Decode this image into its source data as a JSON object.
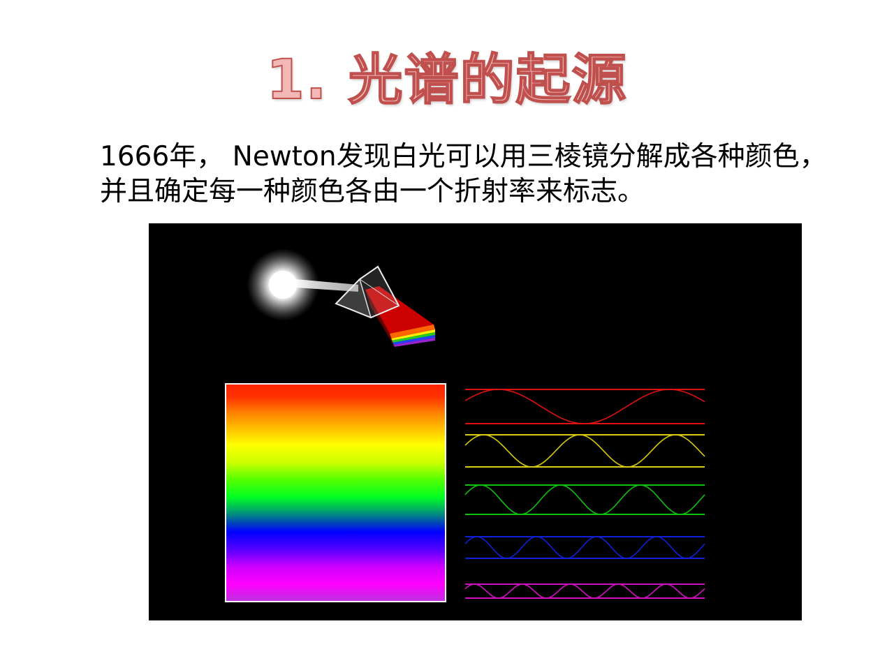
{
  "slide": {
    "title": "1. 光谱的起源",
    "paragraph": "1666年，  Newton发现白光可以用三棱镜分解成各种颜色，并且确定每一种颜色各由一个折射率来标志。"
  },
  "illustration": {
    "background_color": "#000000",
    "light_source_icon": "light-source-icon",
    "prism_icon": "prism-icon",
    "spectrum_colors": [
      "#ff0000",
      "#ff8800",
      "#ffff00",
      "#00ff00",
      "#0000ff",
      "#ff00ff",
      "#aa33cc"
    ],
    "waves": [
      {
        "color": "#e01010",
        "cycles": 1.4
      },
      {
        "color": "#d8cc10",
        "cycles": 2.5
      },
      {
        "color": "#10c010",
        "cycles": 3.0
      },
      {
        "color": "#1020d8",
        "cycles": 4.0
      },
      {
        "color": "#d010c0",
        "cycles": 5.0
      }
    ]
  }
}
